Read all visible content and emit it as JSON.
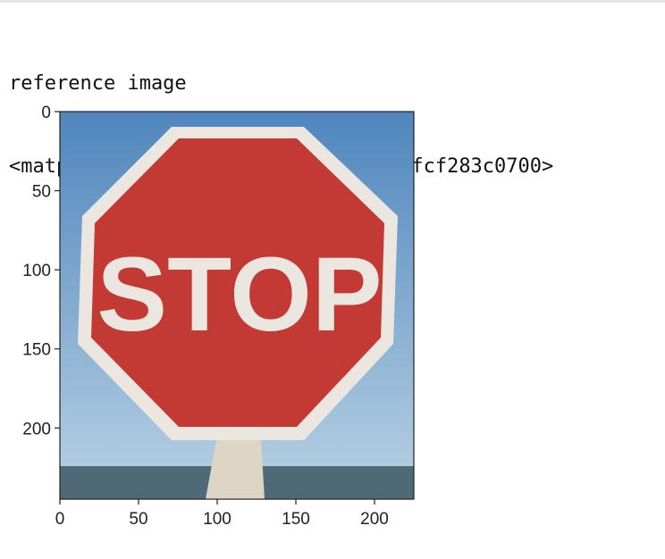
{
  "cell_output": {
    "print_line": "reference image",
    "repr_line": "<matplotlib.image.AxesImage at 0x7fcf283c0700>"
  },
  "image_content": {
    "sign_text": "STOP",
    "sign_color": "#c23a33",
    "border_color": "#ece6e0",
    "sky_top_color": "#4f86bd",
    "sky_bottom_color": "#b9d2e4",
    "ground_color": "#4f6a77",
    "post_color": "#ddd6c4"
  },
  "chart_data": {
    "type": "image",
    "xlim": [
      0,
      225
    ],
    "ylim": [
      245,
      0
    ],
    "x_ticks": [
      "0",
      "50",
      "100",
      "150",
      "200"
    ],
    "y_ticks": [
      "0",
      "50",
      "100",
      "150",
      "200"
    ],
    "x_tick_values": [
      0,
      50,
      100,
      150,
      200
    ],
    "y_tick_values": [
      0,
      50,
      100,
      150,
      200
    ]
  }
}
